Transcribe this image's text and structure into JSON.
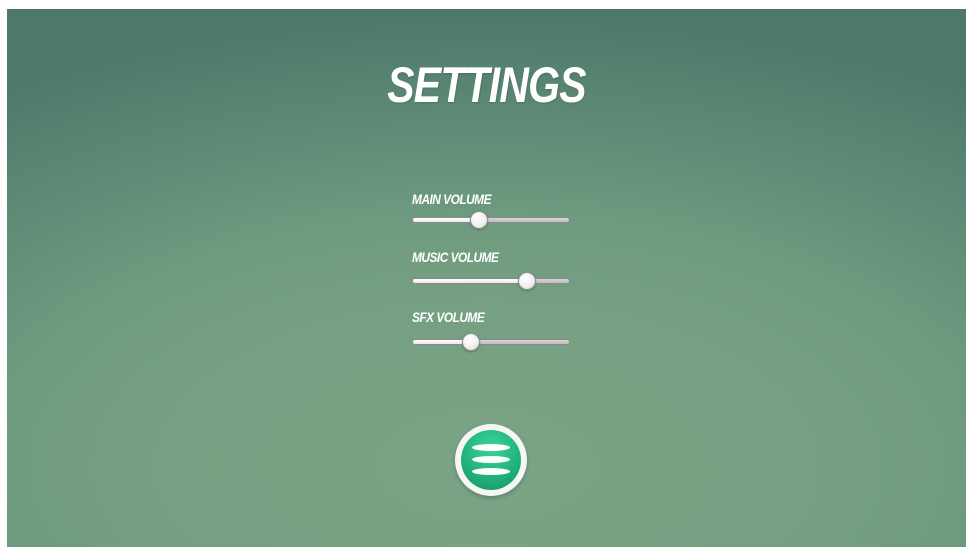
{
  "settings": {
    "title": "SETTINGS",
    "sliders": [
      {
        "label": "MAIN VOLUME",
        "value": 0.42
      },
      {
        "label": "MUSIC VOLUME",
        "value": 0.73
      },
      {
        "label": "SFX VOLUME",
        "value": 0.37
      }
    ],
    "menu_button": {
      "icon": "hamburger-menu-icon"
    }
  },
  "colors": {
    "background": "#6e9a7f",
    "accent": "#22b37d",
    "text": "#ffffff"
  }
}
